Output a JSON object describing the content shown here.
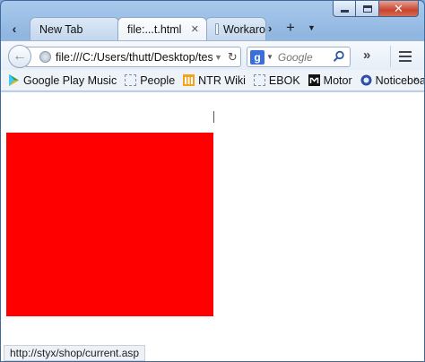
{
  "tabs": [
    {
      "label": "New Tab",
      "active": false
    },
    {
      "label": "file:...t.html",
      "active": true
    },
    {
      "label": "Workaro",
      "active": false
    }
  ],
  "navbar": {
    "url": "file:///C:/Users/thutt/Desktop/test.h",
    "search_placeholder": "Google"
  },
  "bookmarks": [
    {
      "label": "Google Play Music",
      "icon": "play-icon"
    },
    {
      "label": "People",
      "icon": "dotted-folder-icon"
    },
    {
      "label": "NTR Wiki",
      "icon": "wiki-icon"
    },
    {
      "label": "EBOK",
      "icon": "dotted-folder-icon"
    },
    {
      "label": "Motor",
      "icon": "m-icon"
    },
    {
      "label": "Noticeboard",
      "icon": "notice-icon"
    }
  ],
  "content": {
    "box_color": "#ff0000"
  },
  "status": {
    "link": "http://styx/shop/current.asp"
  }
}
